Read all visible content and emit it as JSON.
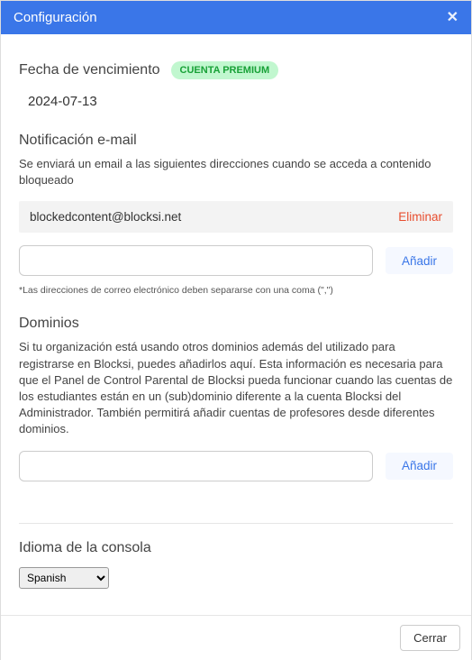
{
  "header": {
    "title": "Configuración"
  },
  "expiry": {
    "label": "Fecha de vencimiento",
    "badge": "CUENTA PREMIUM",
    "date": "2024-07-13"
  },
  "email_notify": {
    "title": "Notificación e-mail",
    "description": "Se enviará un email a las siguientes direcciones cuando se acceda a contenido bloqueado",
    "entries": [
      {
        "address": "blockedcontent@blocksi.net",
        "delete_label": "Eliminar"
      }
    ],
    "add_label": "Añadir",
    "helper": "*Las direcciones de correo electrónico deben separarse con una coma (\",\")"
  },
  "domains": {
    "title": "Dominios",
    "description": "Si tu organización está usando otros dominios además del utilizado para registrarse en Blocksi, puedes añadirlos aquí. Esta información es necesaria para que el Panel de Control Parental de Blocksi pueda funcionar cuando las cuentas de los estudiantes están en un (sub)dominio diferente a la cuenta Blocksi del Administrador. También permitirá añadir cuentas de profesores desde diferentes dominios.",
    "add_label": "Añadir"
  },
  "language": {
    "title": "Idioma de la consola",
    "selected": "Spanish"
  },
  "footer": {
    "close_label": "Cerrar"
  }
}
